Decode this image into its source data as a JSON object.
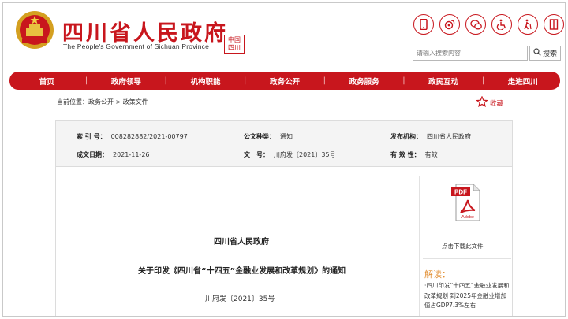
{
  "header": {
    "title": "四川省人民政府",
    "subtitle": "The People's Government of Sichuan Province",
    "seal_text": "中国四川",
    "icons": [
      "mobile-icon",
      "weibo-icon",
      "wechat-icon",
      "accessibility-icon",
      "elderly-icon",
      "font-size-icon"
    ],
    "search": {
      "placeholder": "请输入搜索内容",
      "button_label": "搜索"
    }
  },
  "nav": {
    "items": [
      "首页",
      "政府领导",
      "机构职能",
      "政务公开",
      "政务服务",
      "政民互动",
      "走进四川"
    ]
  },
  "breadcrumb": {
    "prefix": "当前位置：",
    "path": "政务公开 > 政策文件"
  },
  "favorite": {
    "label": "收藏"
  },
  "info": {
    "index_label": "索 引 号：",
    "index_value": "008282882/2021-00797",
    "category_label": "公文种类：",
    "category_value": "通知",
    "issuer_label": "发布机构：",
    "issuer_value": "四川省人民政府",
    "date_label": "成文日期：",
    "date_value": "2021-11-26",
    "doc_no_label": "文　号：",
    "doc_no_value": "川府发〔2021〕35号",
    "validity_label": "有 效 性：",
    "validity_value": "有效"
  },
  "document": {
    "issuer": "四川省人民政府",
    "title": "关于印发《四川省“十四五”金融业发展和改革规划》的通知",
    "number": "川府发〔2021〕35号"
  },
  "sidebar": {
    "pdf_badge": "PDF",
    "pdf_brand": "Adobe",
    "download_label": "点击下载此文件",
    "interpretation_title": "解读：",
    "interpretation_text": "·四川印发“十四五”金融业发展和改革规划 到2025年金融业增加值占GDP7.3%左右"
  },
  "colors": {
    "brand_red": "#c8161d",
    "accent_orange": "#e08a2a",
    "info_bg": "#f4f4f4"
  }
}
